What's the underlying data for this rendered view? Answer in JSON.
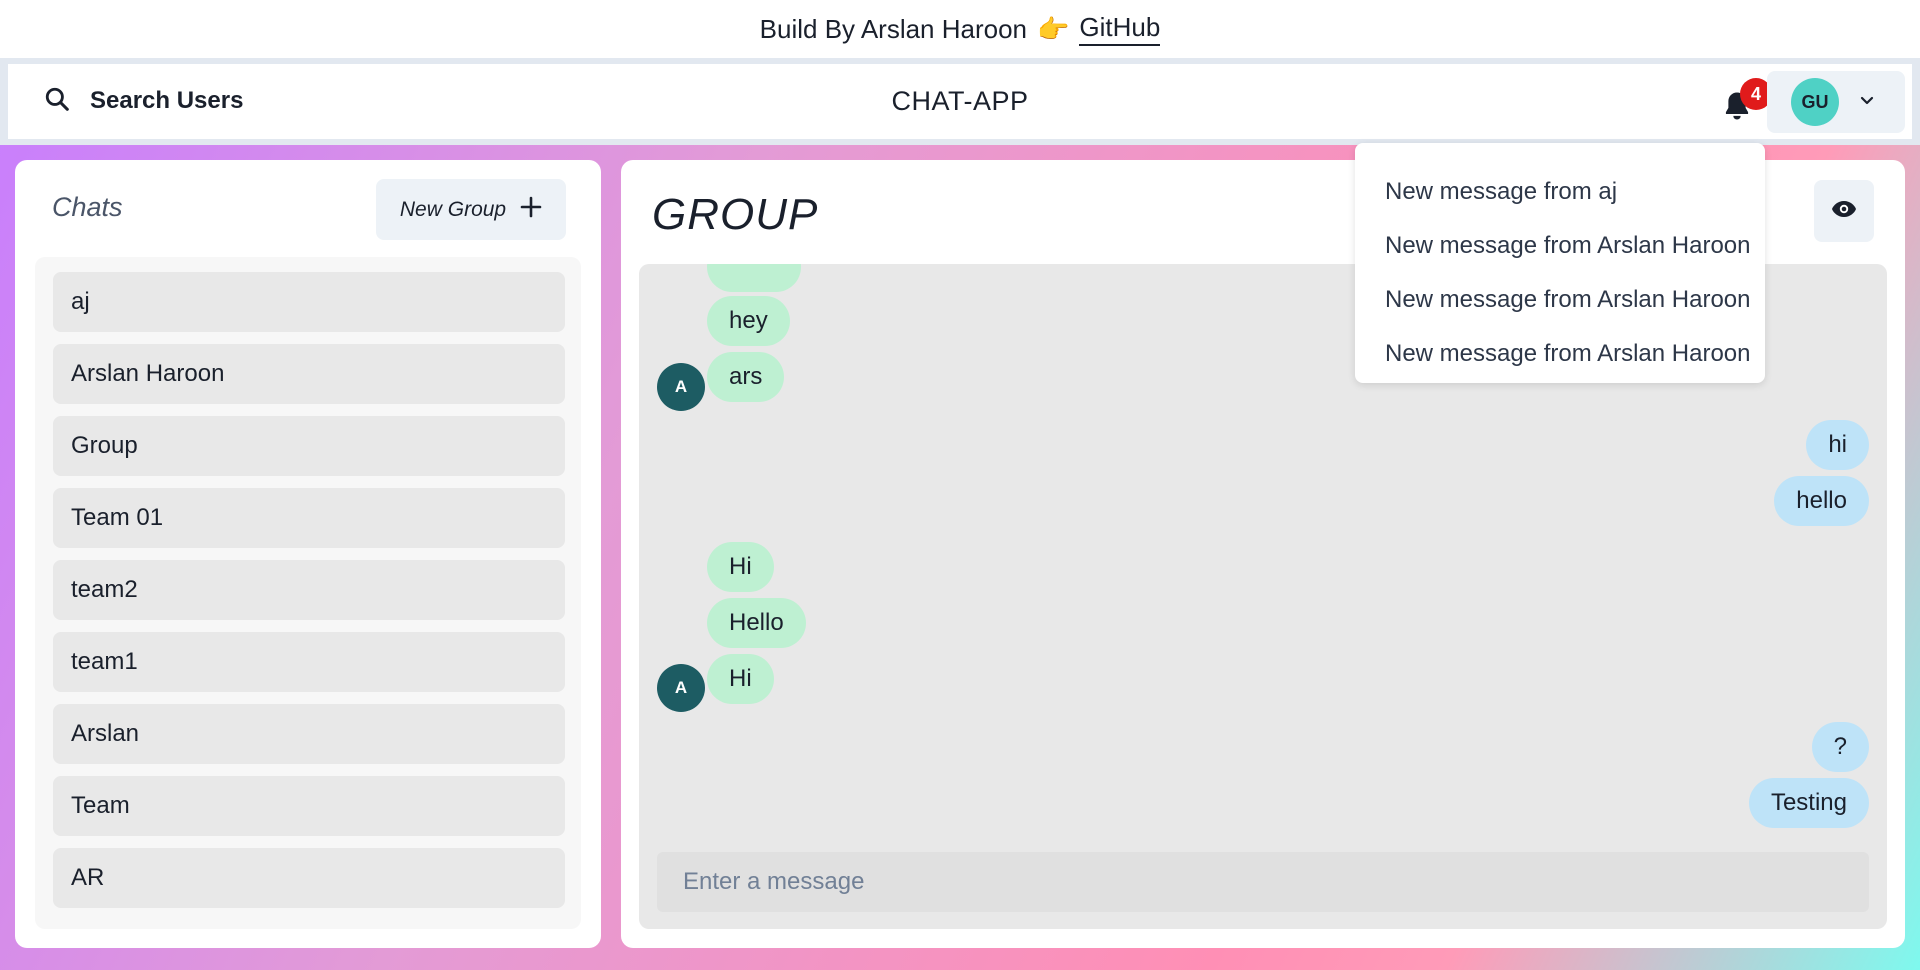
{
  "credit": {
    "text": "Build By Arslan Haroon",
    "pointer": "👉",
    "link_label": "GitHub"
  },
  "header": {
    "search_label": "Search Users",
    "app_title": "CHAT-APP",
    "notification_count": "4",
    "user_initials": "GU"
  },
  "notifications": [
    "New message from aj",
    "New message from Arslan Haroon",
    "New message from Arslan Haroon",
    "New message from Arslan Haroon"
  ],
  "chats": {
    "title": "Chats",
    "new_group_label": "New Group",
    "items": [
      "aj",
      "Arslan Haroon",
      "Group",
      "Team 01",
      "team2",
      "team1",
      "Arslan",
      "Team",
      "AR"
    ]
  },
  "conversation": {
    "title": "GROUP",
    "messages": [
      {
        "text": "",
        "side": "in",
        "avatar": ""
      },
      {
        "text": "hey",
        "side": "in",
        "avatar": ""
      },
      {
        "text": "ars",
        "side": "in",
        "avatar": "A"
      },
      {
        "text": "hi",
        "side": "out",
        "avatar": ""
      },
      {
        "text": "hello",
        "side": "out",
        "avatar": ""
      },
      {
        "text": "Hi",
        "side": "in",
        "avatar": ""
      },
      {
        "text": "Hello",
        "side": "in",
        "avatar": ""
      },
      {
        "text": "Hi",
        "side": "in",
        "avatar": "A"
      },
      {
        "text": "?",
        "side": "out",
        "avatar": ""
      },
      {
        "text": "Testing",
        "side": "out",
        "avatar": ""
      }
    ],
    "input_placeholder": "Enter a message"
  },
  "colors": {
    "incoming_bubble": "#bef0d2",
    "outgoing_bubble": "#bee3f8",
    "sender_avatar": "#1d5c63",
    "user_avatar": "#4fd1c5",
    "badge": "#e01b1b"
  }
}
